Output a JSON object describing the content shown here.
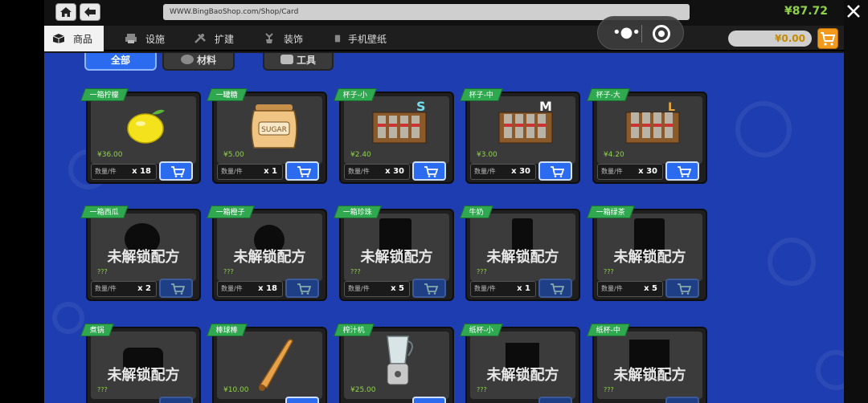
{
  "browser": {
    "url": "WWW.BingBaoShop.com/Shop/Card",
    "balance": "¥87.72"
  },
  "categories": [
    {
      "label": "商品",
      "icon": "box-icon",
      "active": true
    },
    {
      "label": "设施",
      "icon": "printer-icon"
    },
    {
      "label": "扩建",
      "icon": "tools-icon"
    },
    {
      "label": "装饰",
      "icon": "plant-icon"
    },
    {
      "label": "手机壁纸",
      "icon": "phone-icon"
    }
  ],
  "cart": {
    "total": "¥0.00"
  },
  "subtabs": [
    {
      "label": "全部",
      "active": true
    },
    {
      "label": "材料"
    },
    {
      "label": "工具"
    }
  ],
  "locked_text": "未解锁配方",
  "qty_label": "数量/件",
  "items": [
    {
      "name": "一箱柠檬",
      "price": "¥36.00",
      "qty": "x 18",
      "locked": false,
      "icon": "lemon-icon"
    },
    {
      "name": "一罐糖",
      "price": "¥5.00",
      "qty": "x 1",
      "locked": false,
      "icon": "sugar-jar-icon",
      "jar_label": "SUGAR"
    },
    {
      "name": "杯子-小",
      "price": "¥2.40",
      "qty": "x 30",
      "locked": false,
      "icon": "cup-box-icon",
      "size": "S"
    },
    {
      "name": "杯子-中",
      "price": "¥3.00",
      "qty": "x 30",
      "locked": false,
      "icon": "cup-box-icon",
      "size": "M"
    },
    {
      "name": "杯子-大",
      "price": "¥4.20",
      "qty": "x 30",
      "locked": false,
      "icon": "cup-box-icon",
      "size": "L"
    },
    {
      "name": "一箱西瓜",
      "price": "???",
      "qty": "x 2",
      "locked": true,
      "icon": "watermelon-silhouette-icon"
    },
    {
      "name": "一箱橙子",
      "price": "???",
      "qty": "x 18",
      "locked": true,
      "icon": "orange-silhouette-icon"
    },
    {
      "name": "一箱珍珠",
      "price": "???",
      "qty": "x 5",
      "locked": true,
      "icon": "pearl-bag-silhouette-icon"
    },
    {
      "name": "牛奶",
      "price": "???",
      "qty": "x 1",
      "locked": true,
      "icon": "milk-silhouette-icon"
    },
    {
      "name": "一箱绿茶",
      "price": "???",
      "qty": "x 5",
      "locked": true,
      "icon": "tea-bag-silhouette-icon"
    },
    {
      "name": "煮锅",
      "price": "???",
      "qty": "",
      "locked": true,
      "icon": "pot-silhouette-icon"
    },
    {
      "name": "棒球棒",
      "price": "¥10.00",
      "qty": "",
      "locked": false,
      "icon": "baseball-bat-icon"
    },
    {
      "name": "榨汁机",
      "price": "¥25.00",
      "qty": "",
      "locked": false,
      "icon": "juicer-icon"
    },
    {
      "name": "纸杯-小",
      "price": "???",
      "qty": "",
      "locked": true,
      "icon": "paper-cup-silhouette-icon"
    },
    {
      "name": "纸杯-中",
      "price": "???",
      "qty": "",
      "locked": true,
      "icon": "paper-cup-silhouette-icon"
    }
  ],
  "colors": {
    "accent": "#2a6bf0",
    "tag": "#2fa84f",
    "price": "#8fd24a",
    "cart": "#f39a1d",
    "main_bg": "#1d3db0"
  }
}
